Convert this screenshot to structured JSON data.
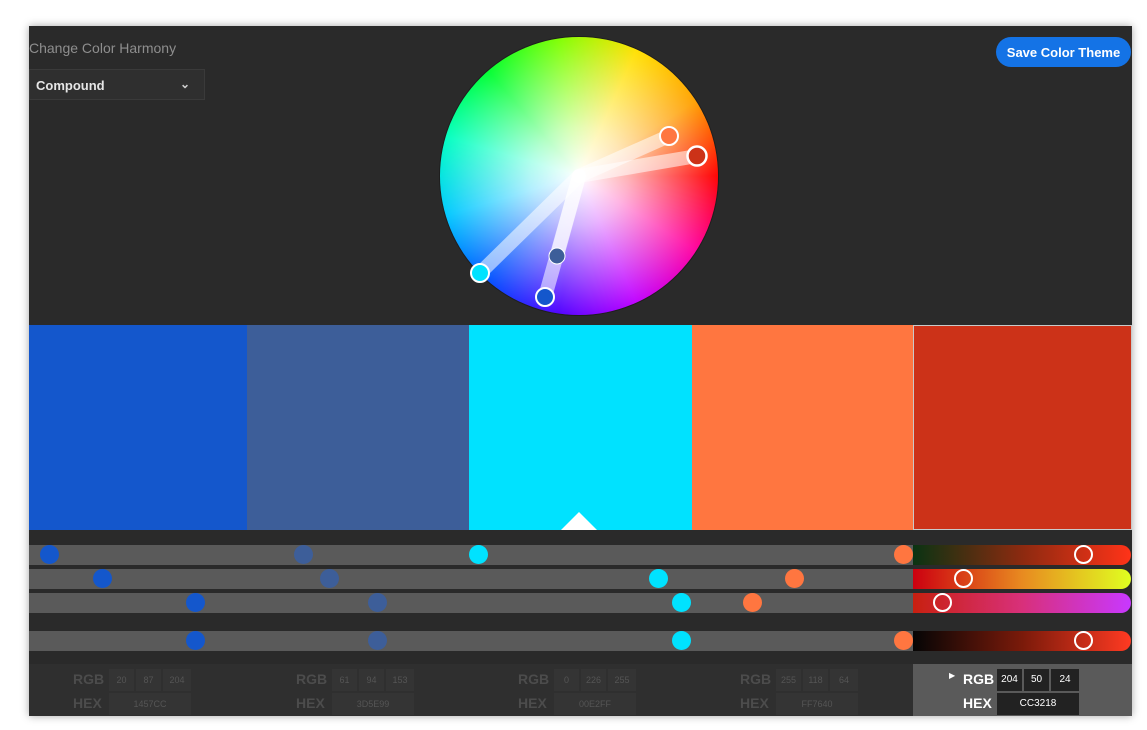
{
  "harmony": {
    "label": "Change Color Harmony",
    "selected": "Compound"
  },
  "save_button": "Save Color Theme",
  "colors": {
    "accent": "#1473e6",
    "background": "#2a2a2a",
    "swatches": [
      "#1457CC",
      "#3D5E99",
      "#00E2FF",
      "#FF7640",
      "#CC3218"
    ]
  },
  "icons": {
    "dropdown": "chevron-down-icon",
    "expand": "caret-right-icon",
    "selected_swatch": "triangle-up-icon"
  },
  "values": [
    {
      "rgb_label": "RGB",
      "hex_label": "HEX",
      "r": "20",
      "g": "87",
      "b": "204",
      "hex": "1457CC"
    },
    {
      "rgb_label": "RGB",
      "hex_label": "HEX",
      "r": "61",
      "g": "94",
      "b": "153",
      "hex": "3D5E99"
    },
    {
      "rgb_label": "RGB",
      "hex_label": "HEX",
      "r": "0",
      "g": "226",
      "b": "255",
      "hex": "00E2FF"
    },
    {
      "rgb_label": "RGB",
      "hex_label": "HEX",
      "r": "255",
      "g": "118",
      "b": "64",
      "hex": "FF7640"
    },
    {
      "rgb_label": "RGB",
      "hex_label": "HEX",
      "r": "204",
      "g": "50",
      "b": "24",
      "hex": "CC3218"
    }
  ],
  "active_swatch": 4
}
